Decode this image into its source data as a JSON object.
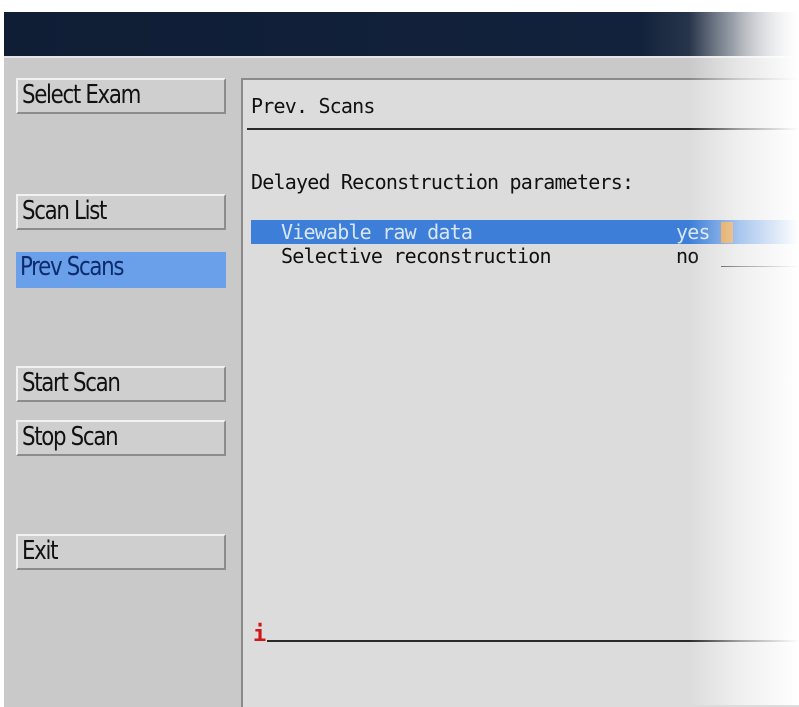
{
  "sidebar": {
    "buttons": [
      {
        "label": "Select Exam",
        "active": false
      },
      {
        "label": "Scan List",
        "active": false
      },
      {
        "label": "Prev Scans",
        "active": true
      },
      {
        "label": "Start Scan",
        "active": false
      },
      {
        "label": "Stop Scan",
        "active": false
      },
      {
        "label": "Exit",
        "active": false
      }
    ]
  },
  "panel": {
    "title": "Prev. Scans",
    "section_title": "Delayed Reconstruction parameters:",
    "params": [
      {
        "label": "Viewable raw data",
        "value": "yes",
        "selected": true
      },
      {
        "label": "Selective reconstruction",
        "value": "no",
        "selected": false
      }
    ],
    "message_marker": "i"
  },
  "colors": {
    "titlebar": "#13223c",
    "active_button": "#6aa0ea",
    "selection": "#3d7fd8",
    "cursor": "#d78a28",
    "info_marker": "#d01616"
  }
}
